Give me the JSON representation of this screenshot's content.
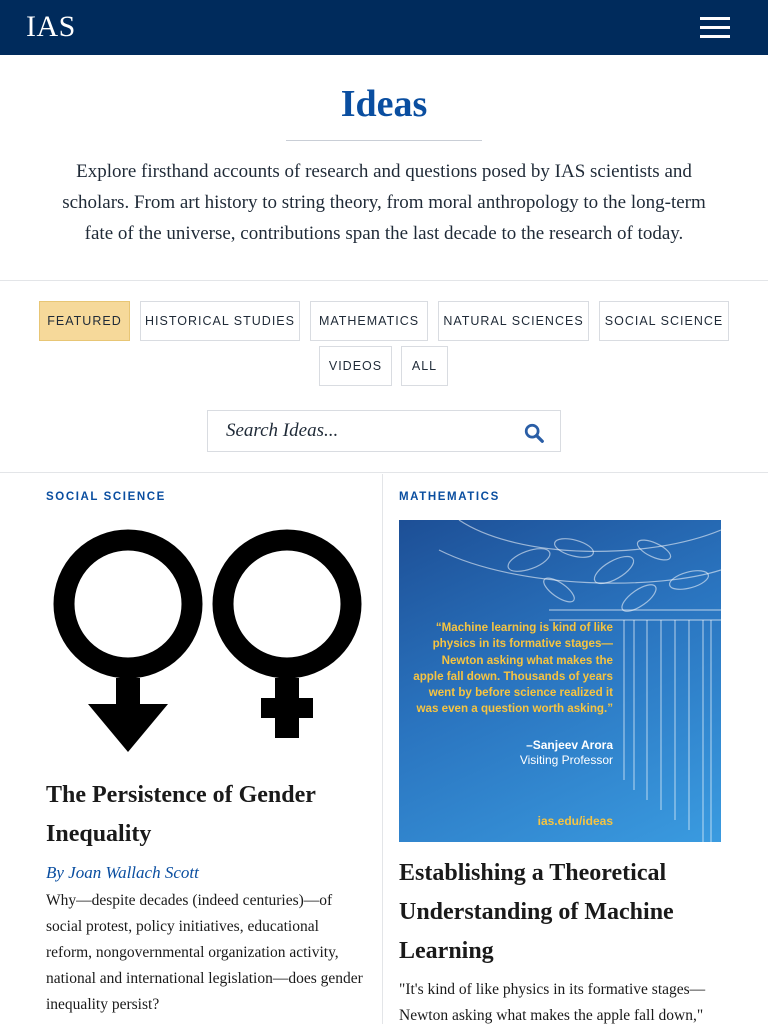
{
  "header": {
    "logo": "IAS"
  },
  "page": {
    "title": "Ideas",
    "intro": "Explore firsthand accounts of research and questions posed by IAS scientists and scholars. From art history to string theory, from moral anthropology to the long-term fate of the universe, contributions span the last decade to the research of today."
  },
  "filters": [
    {
      "label": "FEATURED",
      "active": true
    },
    {
      "label": "HISTORICAL STUDIES",
      "active": false
    },
    {
      "label": "MATHEMATICS",
      "active": false
    },
    {
      "label": "NATURAL SCIENCES",
      "active": false
    },
    {
      "label": "SOCIAL SCIENCE",
      "active": false
    },
    {
      "label": "VIDEOS",
      "active": false
    },
    {
      "label": "ALL",
      "active": false
    }
  ],
  "search": {
    "placeholder": "Search Ideas..."
  },
  "cards": [
    {
      "category": "SOCIAL SCIENCE",
      "title": "The Persistence of Gender Inequality",
      "author": "By Joan Wallach Scott",
      "excerpt": "Why—despite decades (indeed centuries)—of social protest, policy initiatives, educational reform, nongovernmental organization activity, national and international legislation—does gender inequality persist?",
      "image_icon": "gender-symbols-icon"
    },
    {
      "category": "MATHEMATICS",
      "title": "Establishing a Theoretical Understanding of Machine Learning",
      "excerpt": "\"It's kind of like physics in its formative stages—Newton asking what makes the apple fall down,\"",
      "promo": {
        "quote": "“Machine learning is kind of like physics in its formative stages—Newton asking what makes the apple fall down. Thousands of years went by before science realized it was even a question worth asking.”",
        "name": "–Sanjeev Arora",
        "role": "Visiting Professor",
        "url": "ias.edu/ideas"
      }
    }
  ],
  "colors": {
    "topbar": "#002b5c",
    "accent_blue": "#0a4ea0",
    "featured_bg": "#f6d99a",
    "promo_gold": "#f6c441"
  }
}
